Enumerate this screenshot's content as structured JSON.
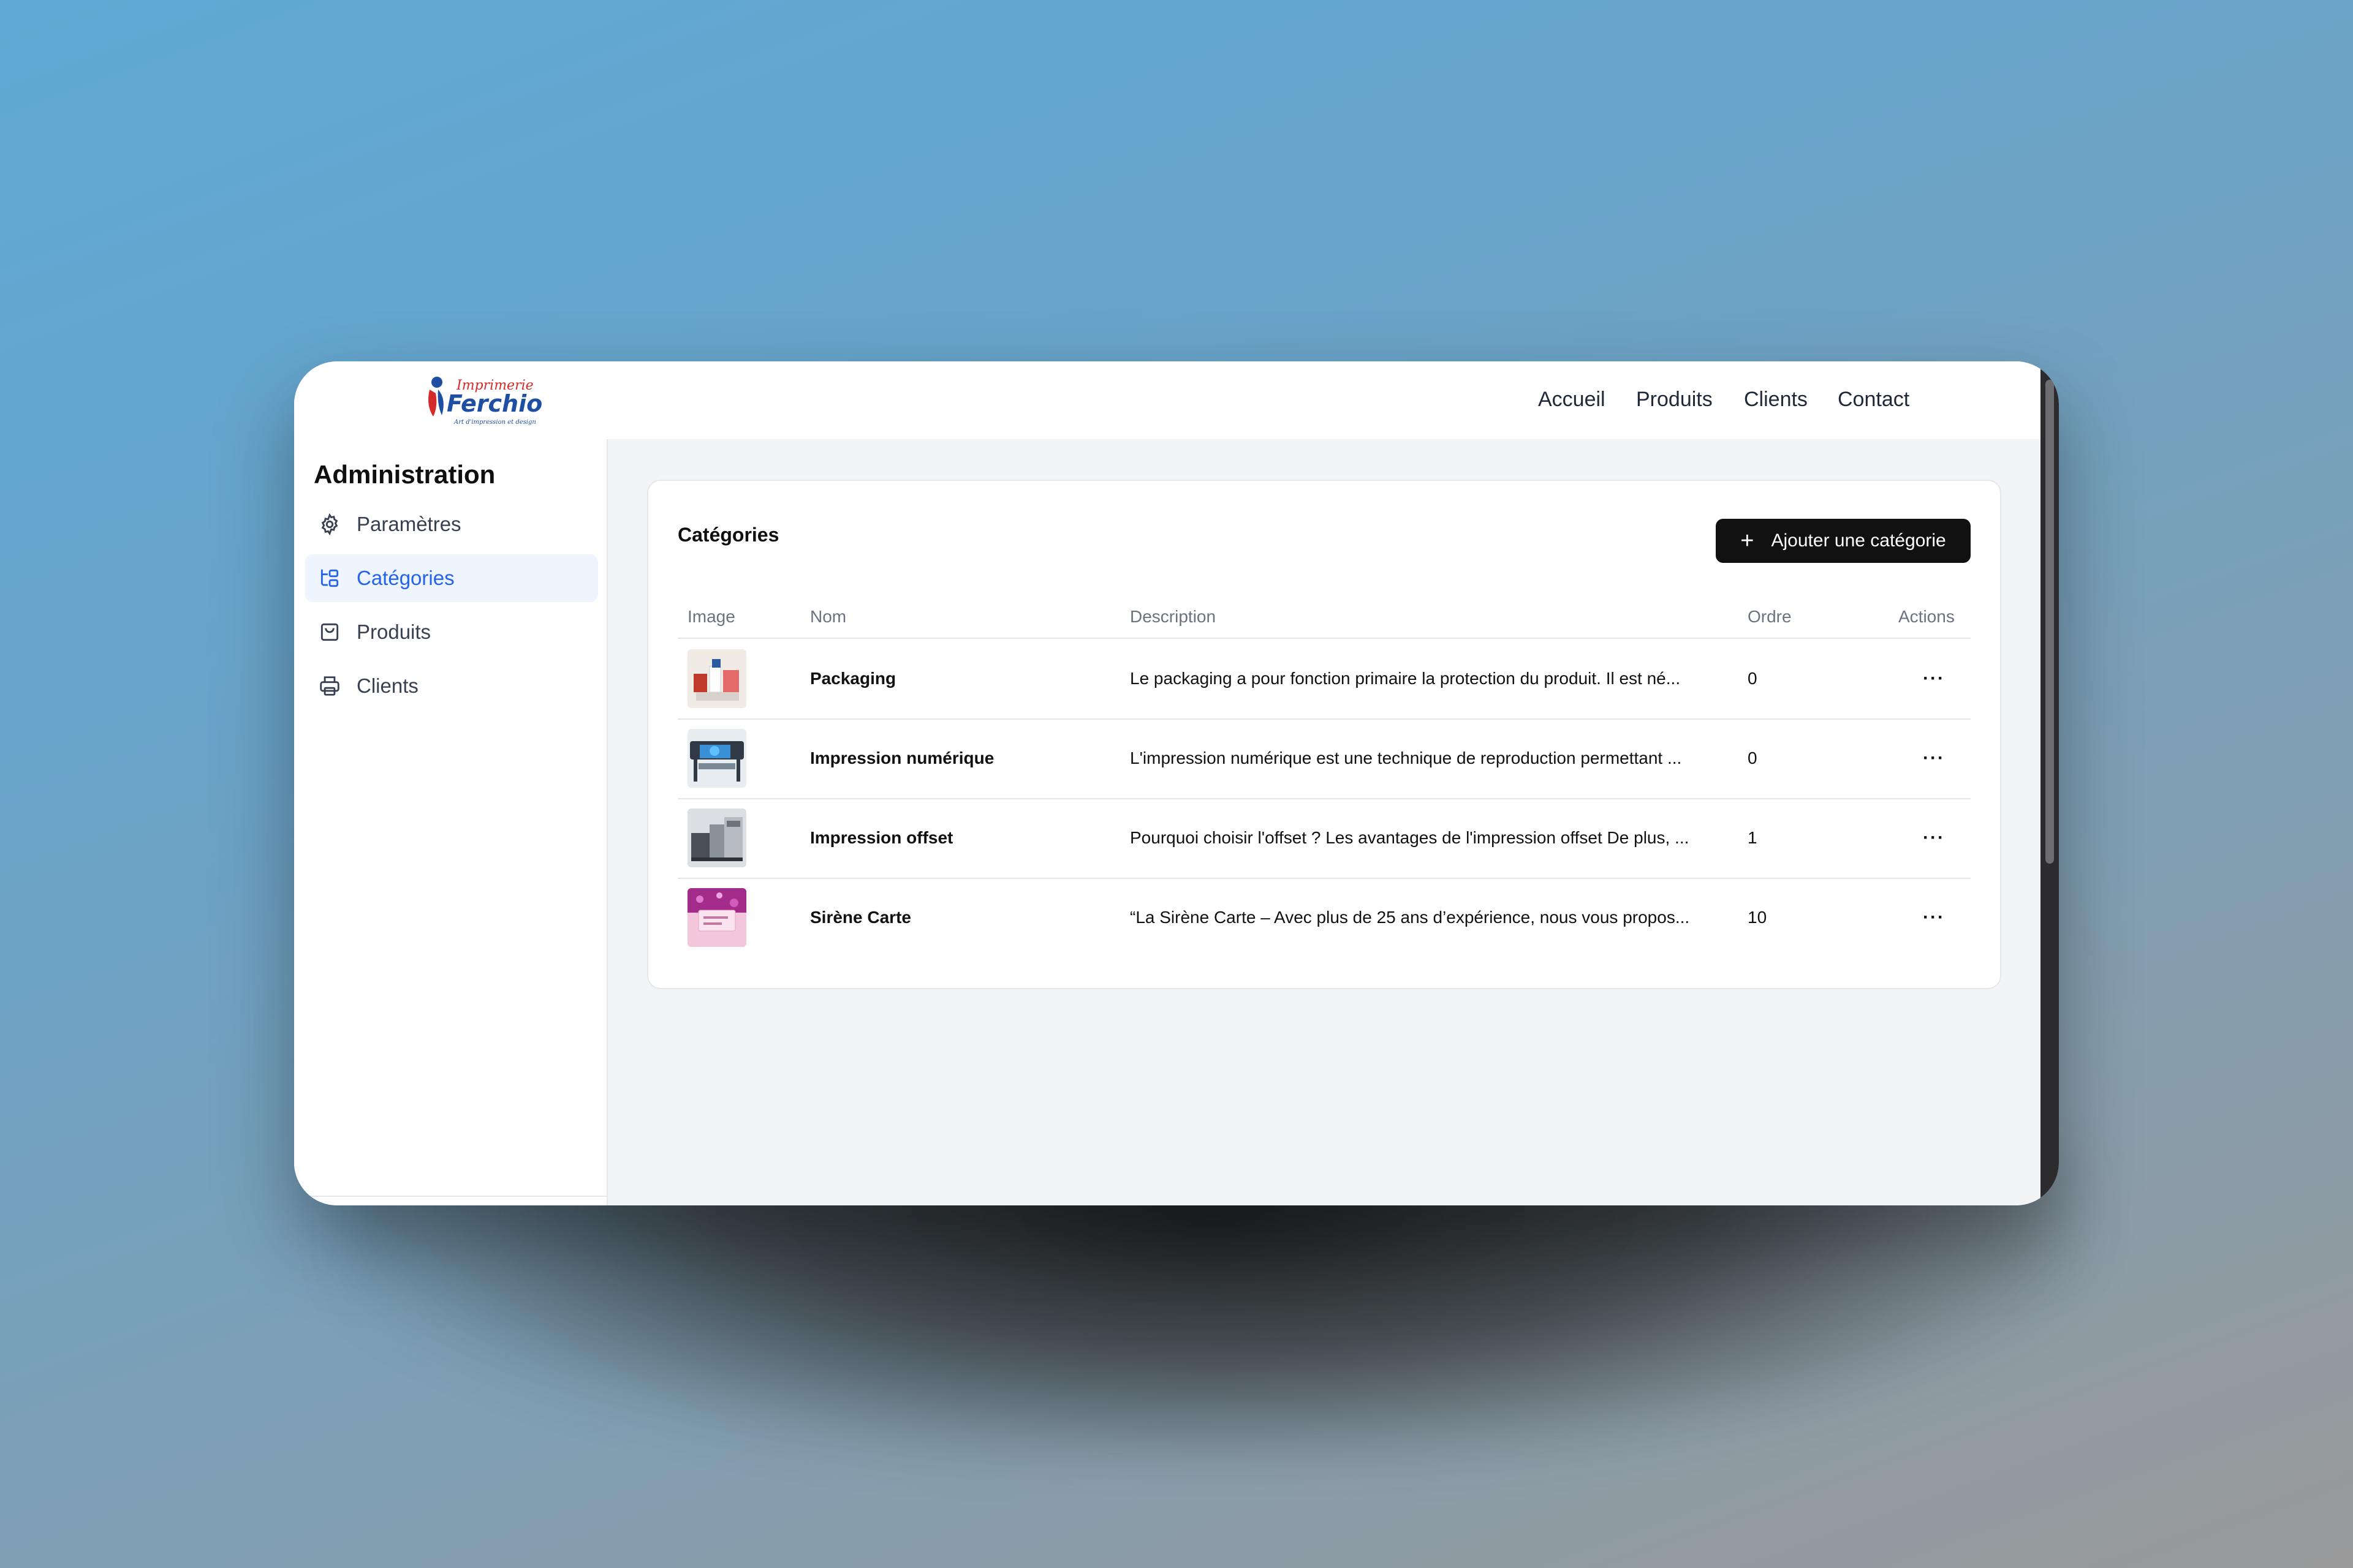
{
  "brand": {
    "logo_line1": "Imprimerie",
    "logo_line2": "Ferchiou",
    "logo_tagline": "Art d'impression et design"
  },
  "nav": [
    "Accueil",
    "Produits",
    "Clients",
    "Contact"
  ],
  "sidebar": {
    "title": "Administration",
    "items": [
      {
        "label": "Paramètres",
        "icon": "gear-icon"
      },
      {
        "label": "Catégories",
        "icon": "category-tree-icon",
        "active": true
      },
      {
        "label": "Produits",
        "icon": "shopping-bag-icon"
      },
      {
        "label": "Clients",
        "icon": "printer-icon"
      }
    ]
  },
  "card": {
    "title": "Catégories",
    "add_button": "Ajouter une catégorie",
    "columns": [
      "Image",
      "Nom",
      "Description",
      "Ordre",
      "Actions"
    ],
    "rows": [
      {
        "name": "Packaging",
        "description": "Le packaging a pour fonction primaire la protection du produit. Il est né...",
        "order": "0",
        "actions": "···"
      },
      {
        "name": "Impression numérique",
        "description": "L'impression numérique est une technique de reproduction permettant ...",
        "order": "0",
        "actions": "···"
      },
      {
        "name": "Impression offset",
        "description": "Pourquoi choisir l'offset ? Les avantages de l'impression offset De plus, ...",
        "order": "1",
        "actions": "···"
      },
      {
        "name": "Sirène Carte",
        "description": "“La Sirène Carte – Avec plus de 25 ans d’expérience, nous vous propos...",
        "order": "10",
        "actions": "···"
      }
    ]
  },
  "colors": {
    "accent": "#2563eb",
    "active_bg": "#eef5ff",
    "button_bg": "#111111",
    "main_bg": "#f3f4f6"
  }
}
